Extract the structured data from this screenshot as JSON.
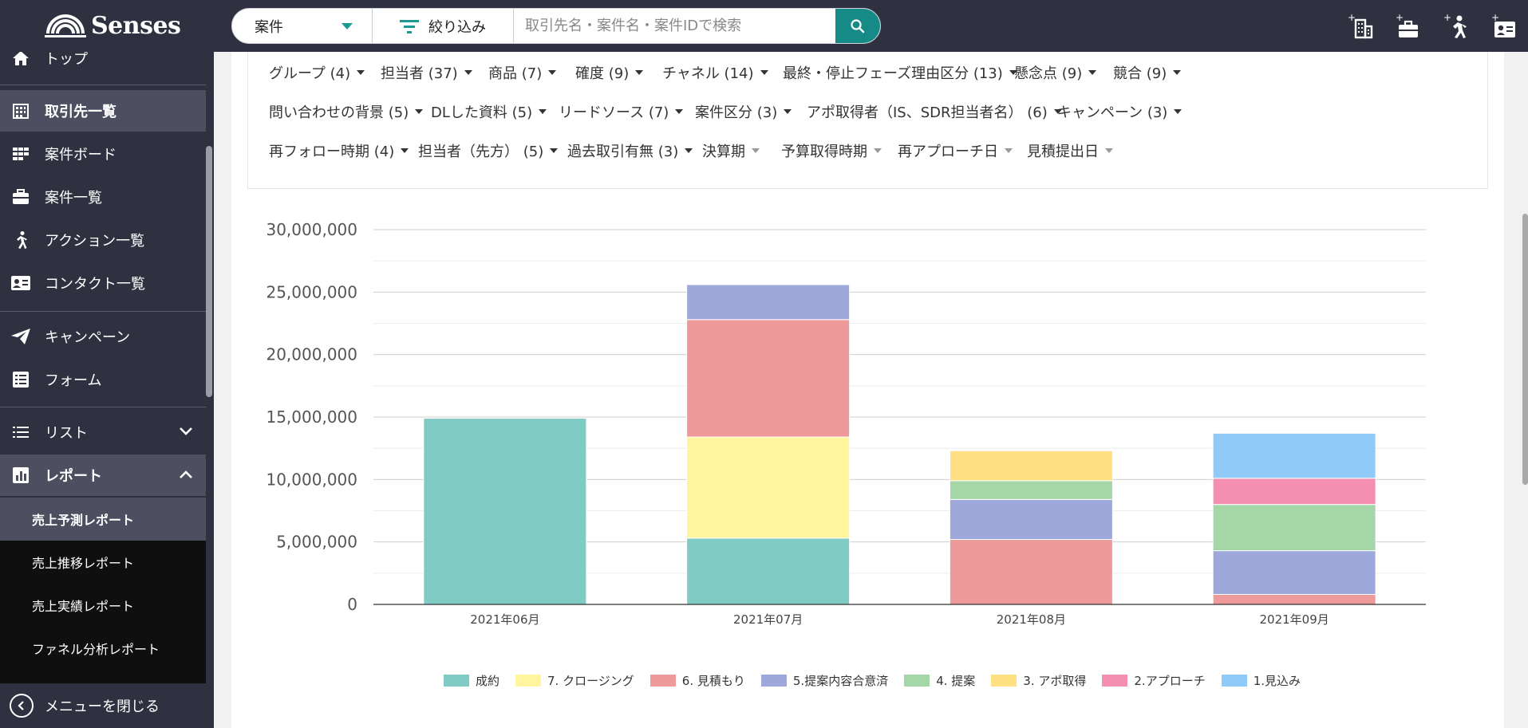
{
  "brand": {
    "name": "Senses"
  },
  "search": {
    "type_value": "案件",
    "filter_label": "絞り込み",
    "placeholder": "取引先名・案件名・案件IDで検索"
  },
  "top_icons": [
    "add-company-icon",
    "add-deal-icon",
    "add-action-icon",
    "add-contact-icon"
  ],
  "sidebar": {
    "items": [
      {
        "label": "トップ",
        "icon": "home-icon"
      },
      {
        "label": "取引先一覧",
        "icon": "building-icon"
      },
      {
        "label": "案件ボード",
        "icon": "board-icon"
      },
      {
        "label": "案件一覧",
        "icon": "briefcase-icon"
      },
      {
        "label": "アクション一覧",
        "icon": "runner-icon"
      },
      {
        "label": "コンタクト一覧",
        "icon": "contact-card-icon"
      },
      {
        "label": "キャンペーン",
        "icon": "paper-plane-icon"
      },
      {
        "label": "フォーム",
        "icon": "form-icon"
      },
      {
        "label": "リスト",
        "icon": "list-icon"
      },
      {
        "label": "レポート",
        "icon": "report-icon"
      }
    ],
    "sub_items": [
      {
        "label": "売上予測レポート"
      },
      {
        "label": "売上推移レポート"
      },
      {
        "label": "売上実績レポート"
      },
      {
        "label": "ファネル分析レポート"
      }
    ],
    "close_label": "メニューを閉じる"
  },
  "filters": {
    "row1": [
      "グループ (4)",
      "担当者 (37)",
      "商品 (7)",
      "確度 (9)",
      "チャネル (14)",
      "最終・停止フェーズ理由区分 (13)",
      "懸念点 (9)",
      "競合 (9)"
    ],
    "row2": [
      "問い合わせの背景 (5)",
      "DLした資料 (5)",
      "リードソース (7)",
      "案件区分 (3)",
      "アポ取得者（IS、SDR担当者名） (6)",
      "キャンペーン (3)"
    ],
    "row3": [
      "再フォロー時期 (4)",
      "担当者（先方） (5)",
      "過去取引有無 (3)",
      "決算期",
      "予算取得時期",
      "再アプローチ日",
      "見積提出日"
    ]
  },
  "chart_data": {
    "type": "bar",
    "stacked": true,
    "categories": [
      "2021年06月",
      "2021年07月",
      "2021年08月",
      "2021年09月"
    ],
    "ylim": [
      0,
      30000000
    ],
    "yticks": [
      "0",
      "5,000,000",
      "10,000,000",
      "15,000,000",
      "20,000,000",
      "25,000,000",
      "30,000,000"
    ],
    "grid": true,
    "legend_position": "bottom",
    "series": [
      {
        "name": "成約",
        "color": "#80cbc4",
        "values": [
          14900000,
          5300000,
          0,
          0
        ]
      },
      {
        "name": "7. クロージング",
        "color": "#fff59d",
        "values": [
          0,
          8100000,
          0,
          0
        ]
      },
      {
        "name": "6. 見積もり",
        "color": "#ef9a9a",
        "values": [
          0,
          9400000,
          5200000,
          800000
        ]
      },
      {
        "name": "5.提案内容合意済",
        "color": "#9fa8da",
        "values": [
          0,
          2800000,
          3200000,
          3500000
        ]
      },
      {
        "name": "4. 提案",
        "color": "#a5d6a7",
        "values": [
          0,
          0,
          1500000,
          3700000
        ]
      },
      {
        "name": "3. アポ取得",
        "color": "#ffe082",
        "values": [
          0,
          0,
          2400000,
          0
        ]
      },
      {
        "name": "2.アプローチ",
        "color": "#f48fb1",
        "values": [
          0,
          0,
          0,
          2100000
        ]
      },
      {
        "name": "1.見込み",
        "color": "#90caf9",
        "values": [
          0,
          0,
          0,
          3600000
        ]
      }
    ]
  }
}
